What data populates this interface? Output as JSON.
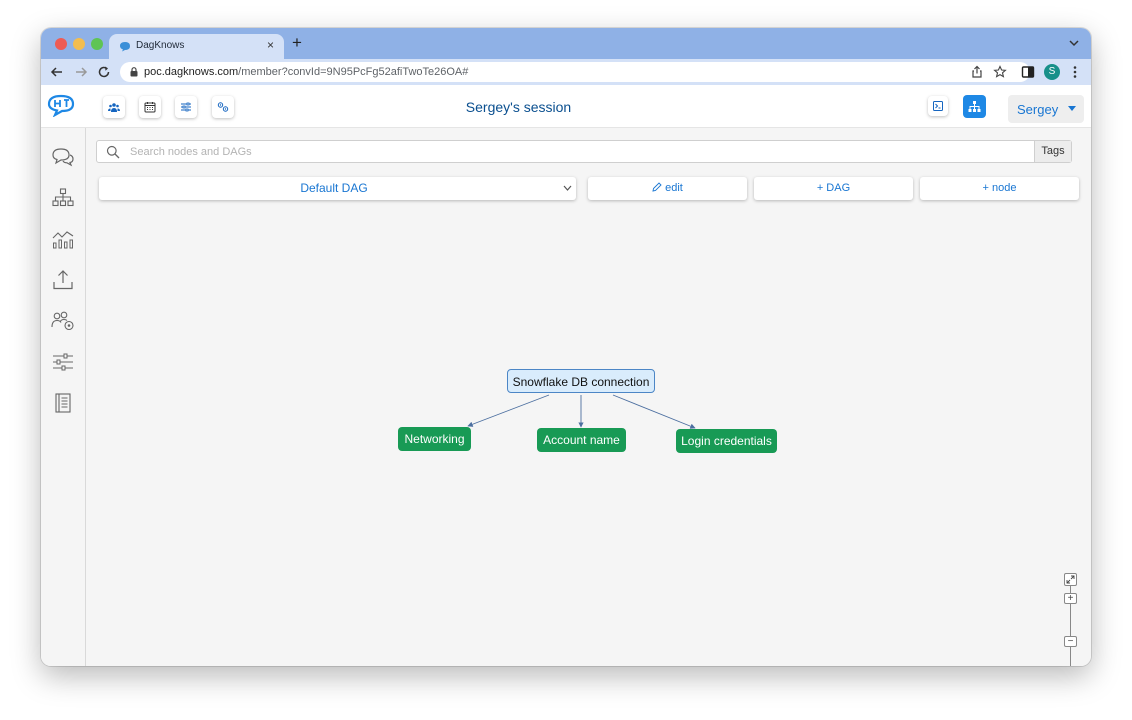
{
  "browser": {
    "tab_title": "DagKnows",
    "tab_close": "×",
    "new_tab": "+",
    "url_host": "poc.dagknows.com",
    "url_path": "/member?convId=9N95PcFg52afiTwoTe26OA#",
    "profile_initial": "S"
  },
  "header": {
    "session_title": "Sergey's session",
    "user_menu": "Sergey"
  },
  "toolbar": {
    "search_placeholder": "Search nodes and DAGs",
    "tags_label": "Tags",
    "dag_select_value": "Default DAG",
    "edit_label": "edit",
    "add_dag_label": "+ DAG",
    "add_node_label": "+ node"
  },
  "graph": {
    "root": "Snowflake DB connection",
    "children": [
      "Networking",
      "Account name",
      "Login credentials"
    ]
  },
  "zoom": {
    "plus": "+",
    "minus": "−"
  },
  "colors": {
    "accent": "#1976d2",
    "node_green": "#189a55",
    "root_fill": "#d9ecfc",
    "root_border": "#4c86c6"
  },
  "icons": {
    "sidebar": [
      "chat-icon",
      "hierarchy-icon",
      "analytics-icon",
      "upload-icon",
      "users-settings-icon",
      "sliders-icon",
      "notebook-icon"
    ],
    "toolbar": [
      "team-icon",
      "calendar-icon",
      "settings-sliders-icon",
      "workflow-icon"
    ]
  }
}
